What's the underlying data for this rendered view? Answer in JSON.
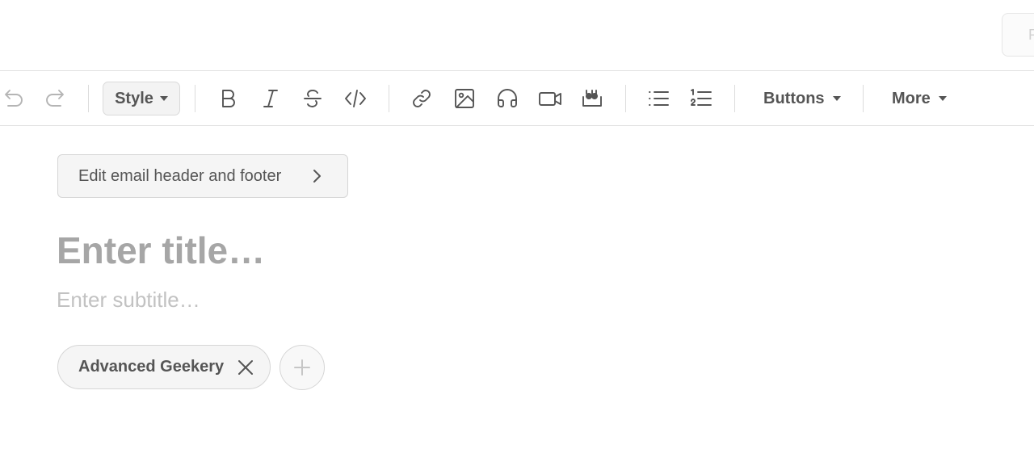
{
  "topbar": {
    "right_button_partial": "P"
  },
  "toolbar": {
    "undo_icon": "undo-icon",
    "redo_icon": "redo-icon",
    "style_label": "Style",
    "buttons_label": "Buttons",
    "more_label": "More",
    "icons": [
      "bold-icon",
      "italic-icon",
      "strikethrough-icon",
      "code-icon",
      "link-icon",
      "image-icon",
      "audio-icon",
      "video-icon",
      "quote-icon",
      "bullet-list-icon",
      "numbered-list-icon"
    ]
  },
  "editor": {
    "edit_header_footer_label": "Edit email header and footer",
    "title_placeholder": "Enter title…",
    "subtitle_placeholder": "Enter subtitle…",
    "tags": [
      {
        "label": "Advanced Geekery"
      }
    ]
  }
}
